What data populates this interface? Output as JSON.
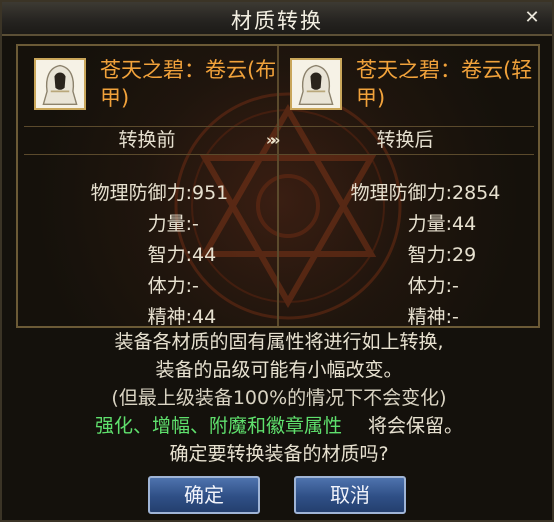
{
  "window": {
    "title": "材质转换",
    "close_symbol": "✕"
  },
  "items": {
    "before": {
      "name": "苍天之碧：卷云(布甲)",
      "icon": "hooded-robe-icon"
    },
    "after": {
      "name": "苍天之碧：卷云(轻甲)",
      "icon": "hooded-robe-icon"
    }
  },
  "headers": {
    "before": "转换前",
    "arrow": "»»",
    "after": "转换后"
  },
  "stats_before": [
    {
      "label": "物理防御力:",
      "value": "951"
    },
    {
      "label": "力量:",
      "value": "-"
    },
    {
      "label": "智力:",
      "value": "44"
    },
    {
      "label": "体力:",
      "value": "-"
    },
    {
      "label": "精神:",
      "value": "44"
    }
  ],
  "stats_after": [
    {
      "label": "物理防御力:",
      "value": "2854"
    },
    {
      "label": "力量:",
      "value": "44"
    },
    {
      "label": "智力:",
      "value": "29"
    },
    {
      "label": "体力:",
      "value": "-"
    },
    {
      "label": "精神:",
      "value": "-"
    }
  ],
  "description": {
    "line1": "装备各材质的固有属性将进行如上转换,",
    "line2": "装备的品级可能有小幅改变。",
    "line3": "(但最上级装备100%的情况下不会变化)",
    "line4_green": "强化、增幅、附魔和徽章属性",
    "line4_rest": "将会保留。",
    "line5": "确定要转换装备的材质吗?"
  },
  "buttons": {
    "confirm": "确定",
    "cancel": "取消"
  },
  "colors": {
    "item_name": "#f1a23b",
    "preserved_text": "#5fe06d",
    "button": "#2f4f86"
  }
}
